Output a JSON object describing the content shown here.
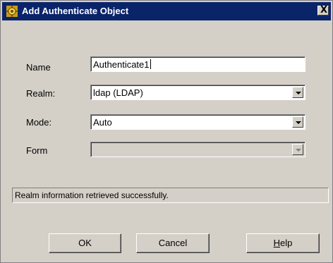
{
  "window": {
    "title": "Add Authenticate Object",
    "close_label": "X"
  },
  "form": {
    "name": {
      "label": "Name",
      "value": "Authenticate1"
    },
    "realm": {
      "label": "Realm:",
      "value": "ldap (LDAP)"
    },
    "mode": {
      "label": "Mode:",
      "value": "Auto"
    },
    "form_field": {
      "label": "Form",
      "value": ""
    }
  },
  "status": {
    "message": "Realm information retrieved successfully."
  },
  "buttons": {
    "ok": "OK",
    "cancel": "Cancel",
    "help_first": "H",
    "help_rest": "elp"
  },
  "icons": {
    "title_icon": "gold-gear-icon",
    "dropdown_arrow": "chevron-down-icon"
  },
  "colors": {
    "titlebar": "#0a246a",
    "dialog_bg": "#d4d0c8"
  }
}
